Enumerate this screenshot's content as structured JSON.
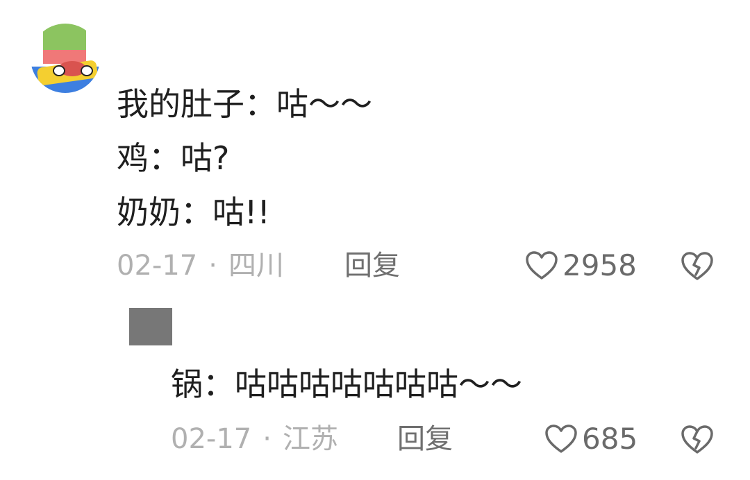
{
  "comment": {
    "avatar": "user-avatar-image",
    "lines": [
      "我的肚子：咕～～",
      "鸡：咕?",
      "奶奶：咕!!"
    ],
    "date": "02-17",
    "separator": "·",
    "location": "四川",
    "reply_label": "回复",
    "like_icon": "heart-outline-icon",
    "like_count": "2958",
    "dislike_icon": "broken-heart-icon"
  },
  "reply": {
    "avatar": "reply-avatar-image",
    "text": "锅：咕咕咕咕咕咕咕～～",
    "date": "02-17",
    "separator": "·",
    "location": "江苏",
    "reply_label": "回复",
    "like_icon": "heart-outline-icon",
    "like_count": "685",
    "dislike_icon": "broken-heart-icon"
  },
  "colors": {
    "text": "#1f1f1f",
    "meta": "#b0b0b0",
    "reply_button": "#6f6f6f",
    "icon": "#6a6a6a"
  }
}
